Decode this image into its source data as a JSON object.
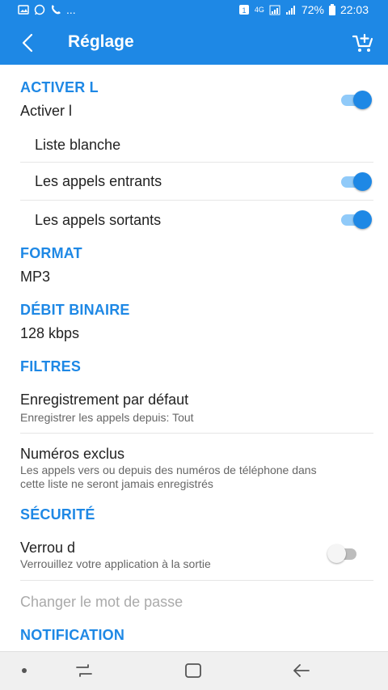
{
  "status_bar": {
    "left_icons": [
      "image-icon",
      "whatsapp-icon",
      "phone-icon"
    ],
    "left_more": "...",
    "battery_percent": "72%",
    "time": "22:03",
    "network": "4G"
  },
  "app_bar": {
    "title": "Réglage",
    "back_icon": "back-arrow-icon",
    "cart_icon": "cart-add-icon"
  },
  "sections": {
    "activate": {
      "header": "ACTIVER L",
      "toggle_label": "Activer l",
      "toggle_on": true,
      "whitelist_label": "Liste blanche",
      "incoming_label": "Les appels entrants",
      "incoming_on": true,
      "outgoing_label": "Les appels sortants",
      "outgoing_on": true
    },
    "format": {
      "header": "FORMAT",
      "value": "MP3"
    },
    "bitrate": {
      "header": "DÉBIT BINAIRE",
      "value": "128 kbps"
    },
    "filters": {
      "header": "FILTRES",
      "default_title": "Enregistrement par défaut",
      "default_sub": "Enregistrer les appels depuis: Tout",
      "excluded_title": "Numéros exclus",
      "excluded_sub_line1": "Les appels vers ou depuis des numéros de téléphone dans",
      "excluded_sub_line2": "cette liste ne seront jamais enregistrés"
    },
    "security": {
      "header": "SÉCURITÉ",
      "lock_title": "Verrou d",
      "lock_sub": "Verrouillez votre application à la sortie",
      "lock_on": false,
      "change_password": "Changer le mot de passe"
    },
    "notification": {
      "header": "NOTIFICATION"
    }
  },
  "colors": {
    "primary": "#1e88e5",
    "switch_track_on": "#90caf9",
    "text": "#222222",
    "subtext": "#666666",
    "disabled": "#aaaaaa"
  }
}
